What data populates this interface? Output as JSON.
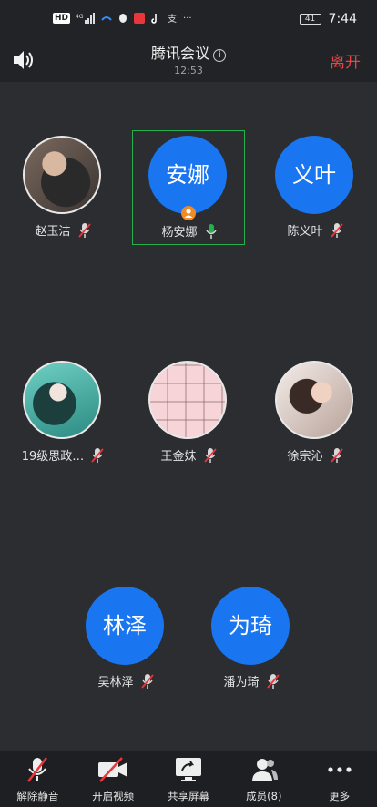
{
  "status_bar": {
    "network": "4G",
    "hd": "HD",
    "battery": "41",
    "time": "7:44"
  },
  "header": {
    "title": "腾讯会议",
    "timer": "12:53",
    "leave_label": "离开",
    "info_icon": "i"
  },
  "participants": [
    {
      "name": "赵玉洁",
      "avatar_type": "photo",
      "muted": true
    },
    {
      "name": "杨安娜",
      "avatar_text": "安娜",
      "avatar_type": "text",
      "muted": false,
      "speaking": true,
      "host": true
    },
    {
      "name": "陈义叶",
      "avatar_text": "义叶",
      "avatar_type": "text",
      "muted": true
    },
    {
      "name": "19级思政…",
      "avatar_type": "photo",
      "muted": true
    },
    {
      "name": "王金妹",
      "avatar_type": "photo",
      "muted": true
    },
    {
      "name": "徐宗沁",
      "avatar_type": "photo",
      "muted": true
    },
    {
      "name": "吴林泽",
      "avatar_text": "林泽",
      "avatar_type": "text",
      "muted": true
    },
    {
      "name": "潘为琦",
      "avatar_text": "为琦",
      "avatar_type": "text",
      "muted": true
    }
  ],
  "toolbar": {
    "unmute": "解除静音",
    "video": "开启视频",
    "share": "共享屏幕",
    "members": "成员(8)",
    "more": "更多"
  },
  "colors": {
    "avatar_blue": "#1a75f0",
    "leave_red": "#e84545",
    "active_green": "#22b14c",
    "muted_red": "#e8363b"
  }
}
